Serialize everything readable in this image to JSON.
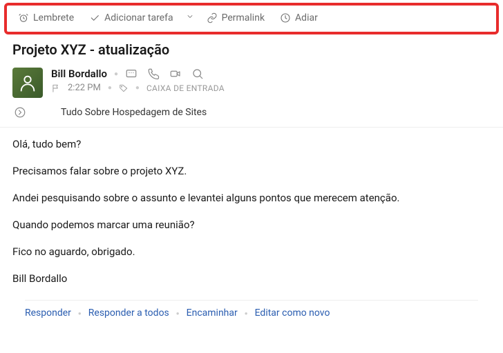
{
  "toolbar": {
    "reminder": "Lembrete",
    "add_task": "Adicionar tarefa",
    "permalink": "Permalink",
    "snooze": "Adiar"
  },
  "subject": "Projeto XYZ - atualização",
  "sender": {
    "name": "Bill Bordallo",
    "time": "2:22 PM",
    "folder": "CAIXA DE ENTRADA"
  },
  "recipient": "Tudo Sobre Hospedagem de Sites",
  "body": {
    "p1": "Olá, tudo bem?",
    "p2": "Precisamos falar sobre o projeto XYZ.",
    "p3": "Andei pesquisando sobre o assunto e levantei alguns pontos que merecem atenção.",
    "p4": "Quando podemos marcar uma reunião?",
    "p5": "Fico no aguardo, obrigado.",
    "p6": "Bill Bordallo"
  },
  "actions": {
    "reply": "Responder",
    "reply_all": "Responder a todos",
    "forward": "Encaminhar",
    "edit_as_new": "Editar como novo"
  }
}
